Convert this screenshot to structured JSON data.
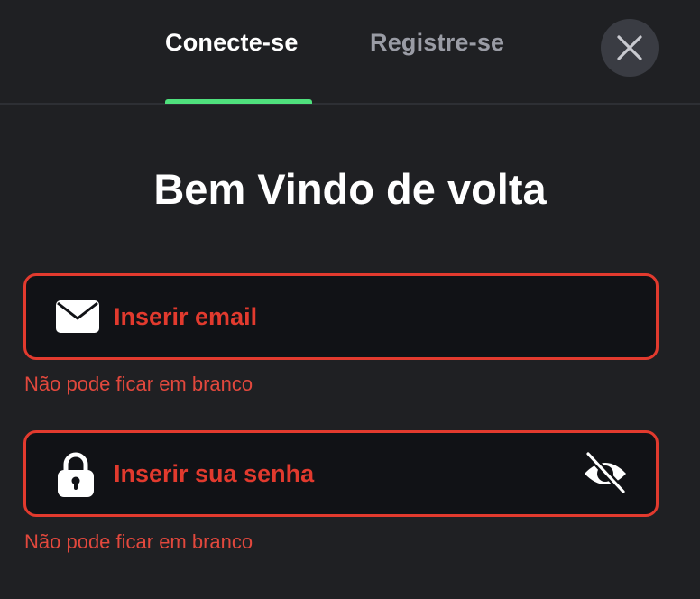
{
  "tabs": {
    "login_label": "Conecte-se",
    "register_label": "Registre-se",
    "active": "login"
  },
  "close_icon": "close-icon",
  "title": "Bem Vindo de volta",
  "email_field": {
    "icon": "envelope-icon",
    "placeholder": "Inserir email",
    "value": "",
    "error": "Não pode ficar em branco"
  },
  "password_field": {
    "icon": "lock-icon",
    "placeholder": "Inserir sua senha",
    "value": "",
    "visibility_icon": "eye-slash-icon",
    "error": "Não pode ficar em branco"
  },
  "colors": {
    "background": "#1f2023",
    "input_background": "#111216",
    "accent": "#4fe07d",
    "error": "#e23a2e",
    "inactive_tab": "#9a9ca5"
  }
}
